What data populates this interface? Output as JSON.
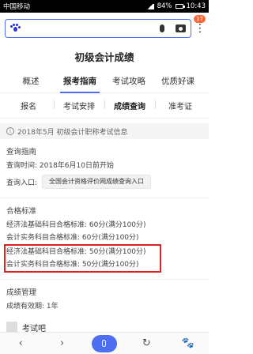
{
  "status_bar": {
    "carrier": "中国移动",
    "battery": "84%",
    "time": "10:43"
  },
  "search": {
    "badge": "17",
    "icons": [
      "baidu-paw-icon",
      "mic-icon",
      "camera-icon",
      "more-icon"
    ]
  },
  "page": {
    "title": "初级会计成绩"
  },
  "tabs_primary": [
    {
      "label": "概述"
    },
    {
      "label": "报考指南"
    },
    {
      "label": "考试攻略"
    },
    {
      "label": "优质好课"
    }
  ],
  "tabs_secondary": [
    {
      "label": "报名"
    },
    {
      "label": "考试安排"
    },
    {
      "label": "成绩查询"
    },
    {
      "label": "准考证"
    }
  ],
  "info_bar": {
    "text": "2018年5月 初级会计职称考试信息"
  },
  "query_guide": {
    "title": "查询指南",
    "time_line": "查询时间: 2018年6月10日前开始",
    "entry_label": "查询入口:",
    "entry_button": "全国会计资格评价网成绩查询入口"
  },
  "pass_standard": {
    "title": "合格标准",
    "lines": [
      "经济法基础科目合格标准: 60分(满分100分)",
      "会计实务科目合格标准: 60分(满分100分)"
    ],
    "highlight_lines": [
      "经济法基础科目合格标准: 50分(满分100分)",
      "会计实务科目合格标准: 50分(满分100分)"
    ]
  },
  "score_management": {
    "title": "成绩管理",
    "validity": "成绩有效期: 1年"
  },
  "next_card": {
    "label": "考试吧"
  },
  "bottom_bar": {
    "items": [
      "back-icon",
      "forward-icon",
      "voice-icon",
      "refresh-icon",
      "baidu-home-icon"
    ]
  }
}
